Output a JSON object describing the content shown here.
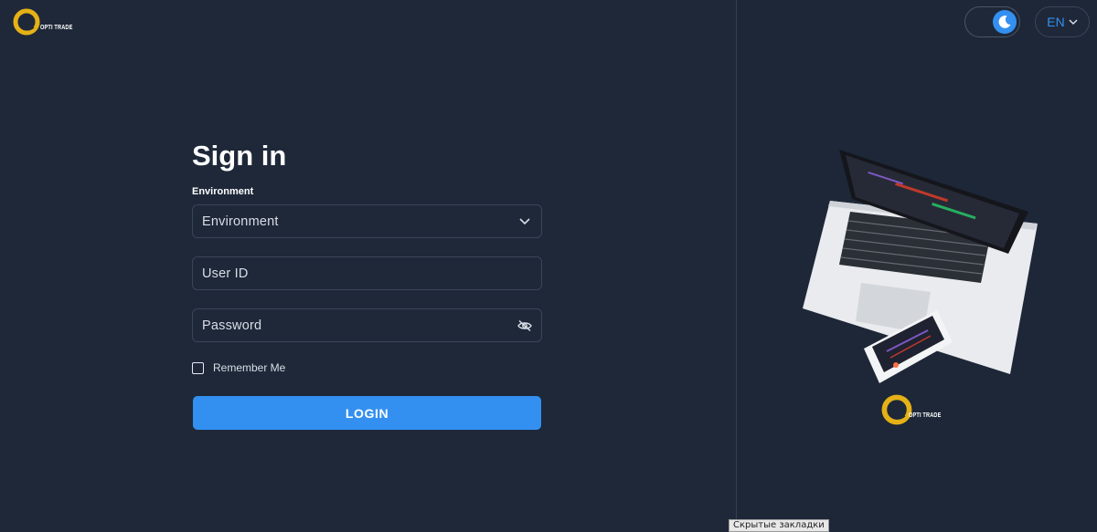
{
  "brand": {
    "name": "OPTI TRADE"
  },
  "colors": {
    "accent": "#3390f0",
    "background": "#1e2839",
    "logo_gold": "#e5b116"
  },
  "signin": {
    "title": "Sign in",
    "environment_label": "Environment",
    "environment_value": "Environment",
    "user_id_placeholder": "User ID",
    "password_placeholder": "Password",
    "remember_label": "Remember Me",
    "login_label": "LOGIN"
  },
  "header": {
    "language": "EN",
    "theme_icon": "moon-icon"
  },
  "browser": {
    "status_text": "Скрытые закладки"
  }
}
